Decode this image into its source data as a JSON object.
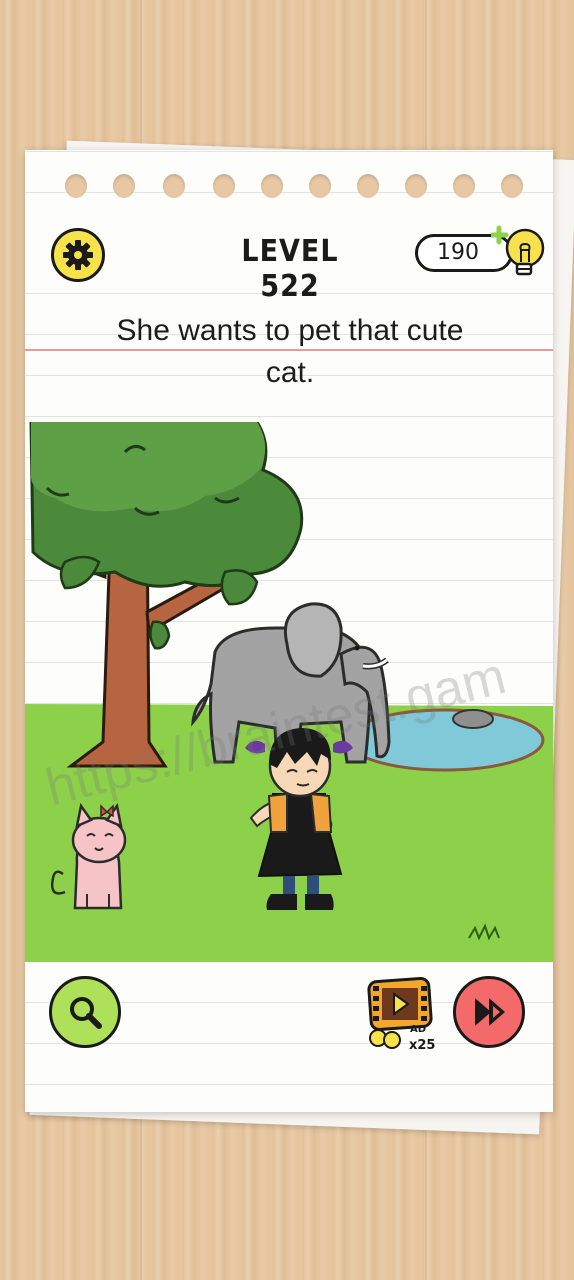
{
  "header": {
    "level_label": "LEVEL 522",
    "hint_count": "190"
  },
  "puzzle": {
    "question_line1": "She wants to pet that cute",
    "question_line2": "cat."
  },
  "bottom": {
    "ad_badge": "AD",
    "ad_multiplier": "x25"
  },
  "watermark": "https://braintest.gam",
  "colors": {
    "gear_button": "#f6e24a",
    "search_button": "#aee05a",
    "skip_button": "#f46a6a",
    "grass": "#8dd14a",
    "pond": "#7fc9d8",
    "elephant": "#a3a3a3",
    "cat": "#f6c3c7"
  }
}
